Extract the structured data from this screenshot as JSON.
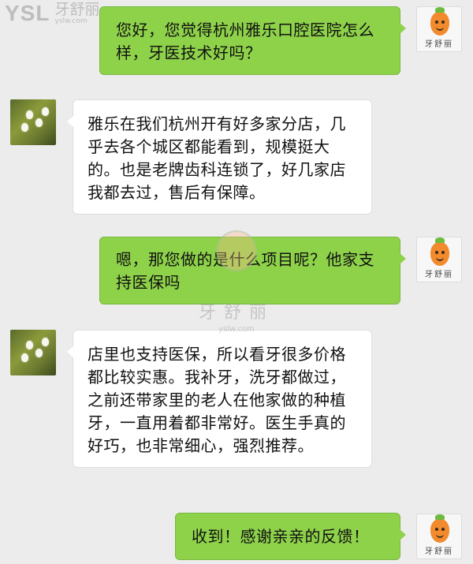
{
  "watermark": {
    "corner_logo": "YSL",
    "corner_name": "牙舒丽",
    "corner_url": "yslw.com",
    "center_name": "牙舒丽",
    "center_url": "yslw.com"
  },
  "contacts": {
    "self_avatar_label": "牙舒丽"
  },
  "messages": [
    {
      "side": "right",
      "text": "您好，您觉得杭州雅乐口腔医院怎么样，牙医技术好吗？"
    },
    {
      "side": "left",
      "text": "雅乐在我们杭州开有好多家分店，几乎去各个城区都能看到，规模挺大的。也是老牌齿科连锁了，好几家店我都去过，售后有保障。"
    },
    {
      "side": "right",
      "text": "嗯，那您做的是什么项目呢？他家支持医保吗"
    },
    {
      "side": "left",
      "text": "店里也支持医保，所以看牙很多价格都比较实惠。我补牙，洗牙都做过，之前还带家里的老人在他家做的种植牙，一直用着都非常好。医生手真的好巧，也非常细心，强烈推荐。"
    },
    {
      "side": "right",
      "text": "收到！感谢亲亲的反馈！"
    }
  ],
  "colors": {
    "background": "#ececec",
    "sent_bubble": "#8ed24a",
    "received_bubble": "#ffffff"
  }
}
